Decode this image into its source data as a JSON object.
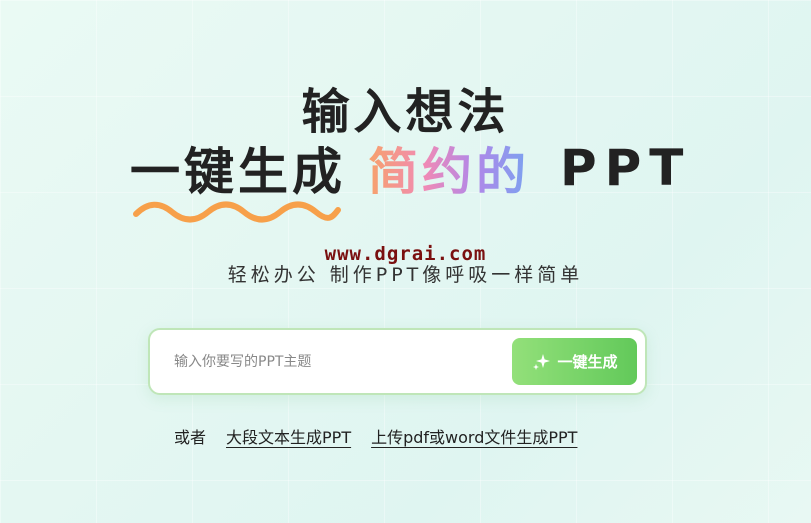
{
  "hero": {
    "title_line1": "输入想法",
    "title_line2_main": "一键生成",
    "title_line2_highlight": "简约的",
    "title_line2_ppt": "PPT",
    "watermark": "www.dgrai.com",
    "subtitle": "轻松办公 制作PPT像呼吸一样简单"
  },
  "search": {
    "placeholder": "输入你要写的PPT主题",
    "value": "",
    "button_label": "一键生成",
    "button_icon": "sparkle-icon"
  },
  "alternatives": {
    "prefix": "或者",
    "link_long_text": "大段文本生成PPT",
    "link_upload": "上传pdf或word文件生成PPT"
  },
  "colors": {
    "accent_green": "#62c95a",
    "squiggle_orange": "#f7a04a",
    "watermark_red": "#7a1010"
  }
}
